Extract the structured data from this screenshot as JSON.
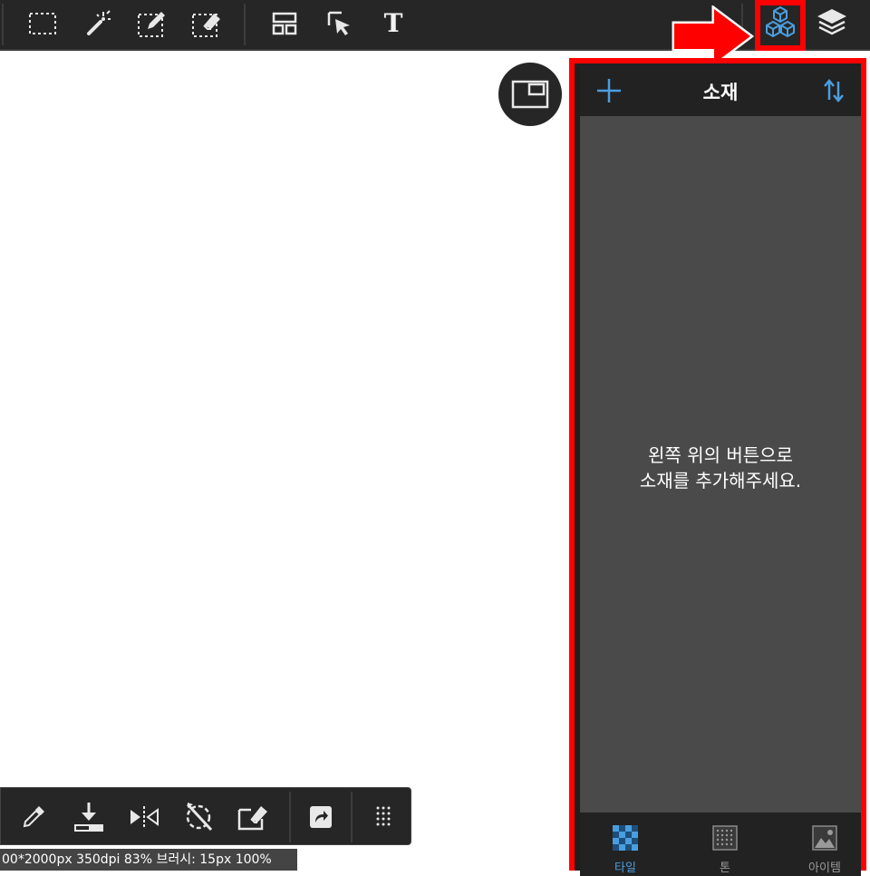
{
  "toolbar": {
    "tools": [
      {
        "name": "rect-select-icon"
      },
      {
        "name": "magic-wand-icon"
      },
      {
        "name": "selection-pen-icon"
      },
      {
        "name": "selection-eraser-icon"
      },
      {
        "name": "frame-divide-icon"
      },
      {
        "name": "object-select-icon"
      },
      {
        "name": "text-tool-icon",
        "label": "T"
      },
      {
        "name": "material-icon",
        "active": true
      },
      {
        "name": "layers-icon"
      }
    ]
  },
  "panel": {
    "title": "소재",
    "empty_message": "왼쪽 위의 버튼으로\n소재를 추가해주세요.",
    "tabs": [
      {
        "label": "타일",
        "icon": "tile-icon",
        "active": true
      },
      {
        "label": "톤",
        "icon": "tone-icon",
        "active": false
      },
      {
        "label": "아이템",
        "icon": "item-icon",
        "active": false
      }
    ]
  },
  "status": {
    "text": "00*2000px 350dpi 83% 브러시: 15px 100%"
  },
  "colors": {
    "accent": "#4a9ee0",
    "highlight": "#ff0000",
    "toolbar_bg": "#262626",
    "panel_body_bg": "#4a4a4a"
  }
}
